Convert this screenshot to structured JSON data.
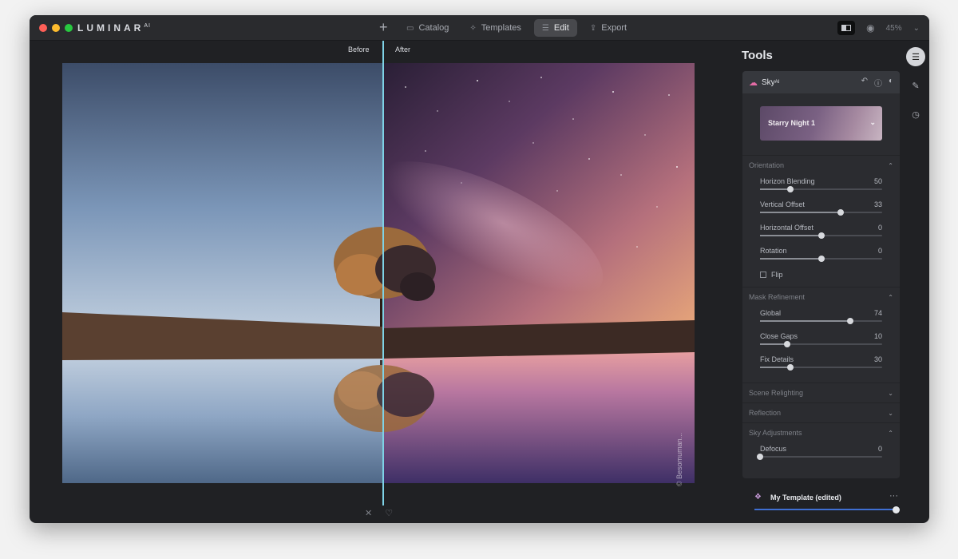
{
  "app": {
    "logo": "LUMINAR",
    "logo_sup": "AI"
  },
  "toolbar": {
    "add_icon": "+",
    "nav": [
      {
        "label": "Catalog",
        "icon": "folder-icon",
        "glyph": "▭"
      },
      {
        "label": "Templates",
        "icon": "templates-icon",
        "glyph": "✧"
      },
      {
        "label": "Edit",
        "icon": "sliders-icon",
        "glyph": "☰",
        "active": true
      },
      {
        "label": "Export",
        "icon": "export-icon",
        "glyph": "⇪"
      }
    ],
    "zoom": "45%"
  },
  "canvas": {
    "before_label": "Before",
    "after_label": "After",
    "watermark": "© Besomuman..."
  },
  "tools": {
    "title": "Tools",
    "panel": {
      "name": "Sky",
      "name_sup": "AI",
      "preset": "Starry Night 1",
      "sections": {
        "orientation": {
          "title": "Orientation",
          "sliders": [
            {
              "label": "Horizon Blending",
              "value": "50",
              "fraction": 0.25
            },
            {
              "label": "Vertical Offset",
              "value": "33",
              "fraction": 0.66
            },
            {
              "label": "Horizontal Offset",
              "value": "0",
              "fraction": 0.5
            },
            {
              "label": "Rotation",
              "value": "0",
              "fraction": 0.5
            }
          ],
          "flip_label": "Flip"
        },
        "mask": {
          "title": "Mask Refinement",
          "sliders": [
            {
              "label": "Global",
              "value": "74",
              "fraction": 0.74
            },
            {
              "label": "Close Gaps",
              "value": "10",
              "fraction": 0.22
            },
            {
              "label": "Fix Details",
              "value": "30",
              "fraction": 0.25
            }
          ]
        },
        "scene_relighting": {
          "title": "Scene Relighting"
        },
        "reflection": {
          "title": "Reflection"
        },
        "sky_adjustments": {
          "title": "Sky Adjustments",
          "sliders": [
            {
              "label": "Defocus",
              "value": "0",
              "fraction": 0.0
            }
          ]
        }
      }
    },
    "template_name": "My Template (edited)",
    "template_more": "···",
    "template_amount": 1.0
  },
  "colors": {
    "divider": "#7ed2e6",
    "accent_blue": "#3f6fd2",
    "sky_icon": "#e46ba5"
  }
}
